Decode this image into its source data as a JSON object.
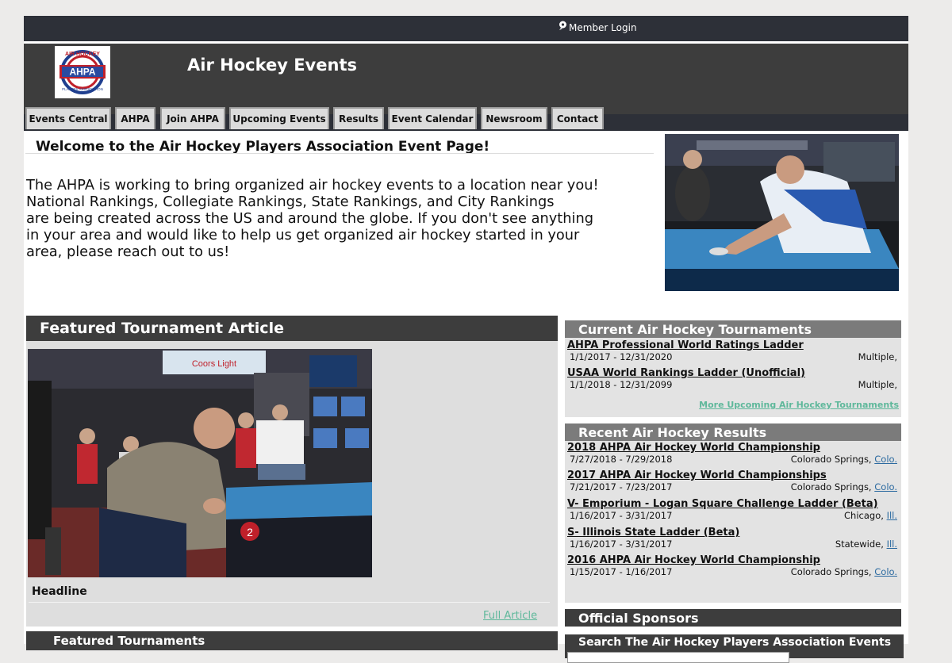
{
  "topbar": {
    "member_login": "Member Login"
  },
  "header": {
    "site_title": "Air Hockey Events",
    "logo_arc_text": "AIR HOCKEY",
    "logo_text": "AHPA",
    "logo_bottom_text": "PLAYERS ASSOCIATION"
  },
  "nav": {
    "tabs": [
      {
        "label": "Events Central"
      },
      {
        "label": "AHPA"
      },
      {
        "label": "Join AHPA"
      },
      {
        "label": "Upcoming Events"
      },
      {
        "label": "Results"
      },
      {
        "label": "Event Calendar"
      },
      {
        "label": "Newsroom"
      },
      {
        "label": "Contact"
      }
    ]
  },
  "welcome": {
    "heading": "Welcome to the Air Hockey Players Association Event Page!",
    "intro": "The AHPA is working to bring organized air hockey events to a location near you!\nNational Rankings, Collegiate Rankings, State Rankings, and City Rankings\nare being created across the US and around the globe.  If you don't see anything\nin your area and would like to help us get organized air hockey started in your\narea, please reach out to us!"
  },
  "featured": {
    "title": "Featured Tournament Article",
    "headline": "Headline",
    "full_article_link": "Full Article",
    "photo_banner_text": "Coors Light",
    "table_number": "2",
    "next_section_title": "Featured Tournaments"
  },
  "current_tournaments": {
    "title": "Current Air Hockey Tournaments",
    "items": [
      {
        "title": "AHPA Professional World Ratings Ladder",
        "dates": "1/1/2017 - 12/31/2020",
        "location": "Multiple,",
        "state": ""
      },
      {
        "title": "USAA World Rankings Ladder (Unofficial)",
        "dates": "1/1/2018 - 12/31/2099",
        "location": "Multiple,",
        "state": ""
      }
    ],
    "more_link": "More Upcoming Air Hockey Tournaments"
  },
  "recent_results": {
    "title": "Recent Air Hockey Results",
    "items": [
      {
        "title": "2018 AHPA Air Hockey World Championship",
        "dates": "7/27/2018 - 7/29/2018",
        "location": "Colorado Springs, ",
        "state": "Colo."
      },
      {
        "title": "2017 AHPA Air Hockey World Championships",
        "dates": "7/21/2017 - 7/23/2017",
        "location": "Colorado Springs, ",
        "state": "Colo."
      },
      {
        "title": "V- Emporium - Logan Square Challenge Ladder (Beta)",
        "dates": "1/16/2017 - 3/31/2017",
        "location": "Chicago, ",
        "state": "Ill."
      },
      {
        "title": "S- Illinois State Ladder (Beta)",
        "dates": "1/16/2017 - 3/31/2017",
        "location": "Statewide, ",
        "state": "Ill."
      },
      {
        "title": "2016 AHPA Air Hockey World Championship",
        "dates": "1/15/2017 - 1/16/2017",
        "location": "Colorado Springs, ",
        "state": "Colo."
      }
    ]
  },
  "sponsors": {
    "title": "Official Sponsors"
  },
  "search": {
    "title": "Search The Air Hockey Players Association Events"
  },
  "colors": {
    "dark_bar": "#3d3d3d",
    "topbar": "#2d3038",
    "panel_grey": "#7b7b7b",
    "link_green": "#5fb89b",
    "link_blue": "#2c6aa0"
  }
}
